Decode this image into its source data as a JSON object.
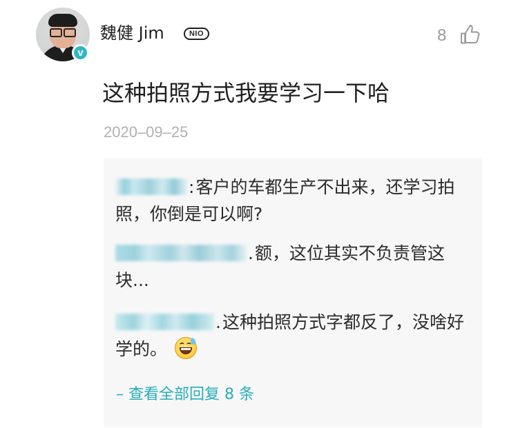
{
  "comment": {
    "author": "魏健 Jim",
    "badge": "NIO",
    "verified_mark": "v",
    "text": "这种拍照方式我要学习一下哈",
    "date": "2020–09–25",
    "likes": "8",
    "icons": {
      "avatar": "user-avatar",
      "verified": "verified-badge-icon",
      "like": "thumbs-up-icon"
    },
    "colors": {
      "accent": "#25aeb8",
      "verified": "#30b7c5",
      "muted": "#999999",
      "reply_background": "#f7f7f7"
    }
  },
  "replies": [
    {
      "separator": ":",
      "text": "客户的车都生产不出来，还学习拍照，你倒是可以啊?"
    },
    {
      "separator": ".",
      "text": "额，这位其实不负责管这块..."
    },
    {
      "separator": ".",
      "text": "这种拍照方式字都反了，没啥好学的。",
      "emoji": "grinning-face-with-sweat-icon"
    }
  ],
  "view_all_replies": "– 查看全部回复 8 条"
}
